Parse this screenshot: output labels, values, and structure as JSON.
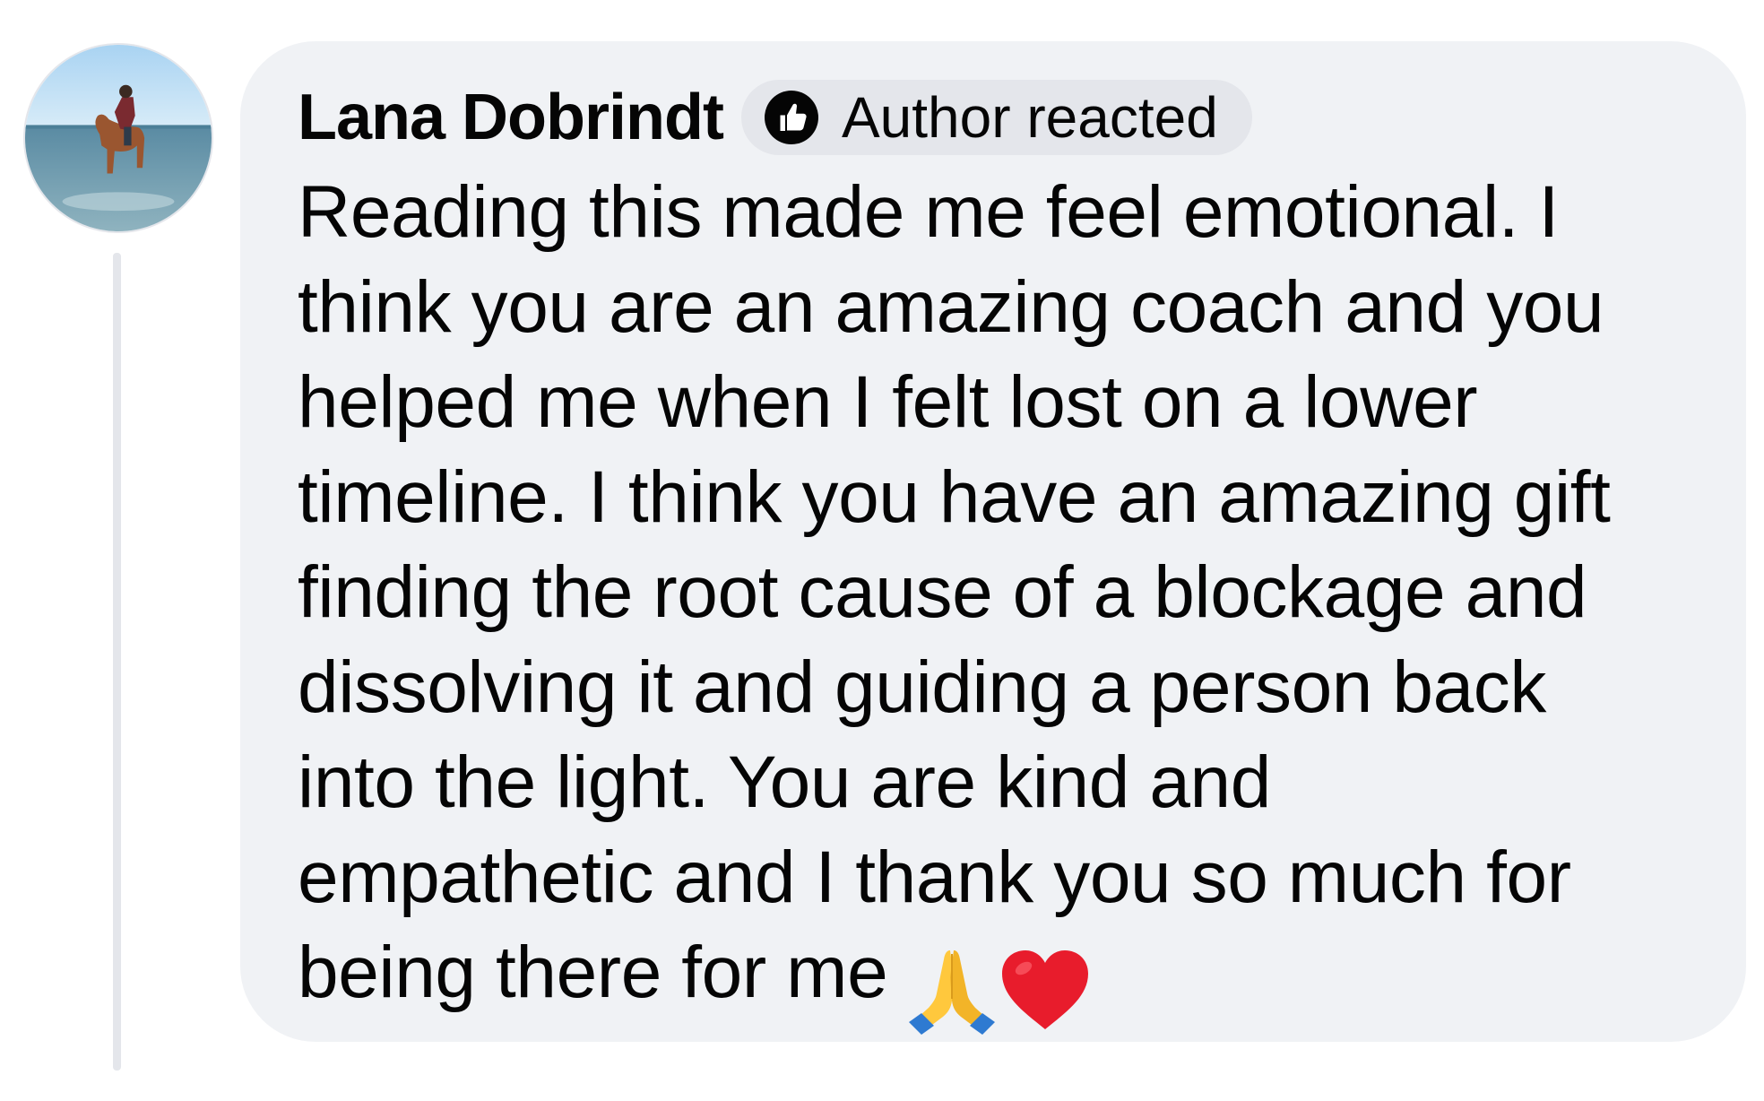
{
  "comment": {
    "author": {
      "name": "Lana Dobrindt",
      "avatar_icon": "avatar-rider-on-horse-beach"
    },
    "badge": {
      "label": "Author reacted",
      "icon": "thumbs-up-icon"
    },
    "text_lines": [
      "Reading this made me feel emotional. I",
      "think you are an amazing coach and you",
      "helped me when I felt lost on a lower",
      "timeline. I think you have an amazing gift",
      "finding the root cause of a blockage and",
      "dissolving it and guiding a person back",
      "into the light. You are kind and",
      "empathetic and I thank you so much for",
      "being there for me"
    ],
    "emojis": [
      "folded-hands-emoji",
      "red-heart-emoji"
    ]
  },
  "colors": {
    "bubble_background": "#f0f2f5",
    "badge_background": "#e4e6eb",
    "thread_line": "#e4e6eb",
    "text": "#050505",
    "heart": "#e81c2c"
  }
}
